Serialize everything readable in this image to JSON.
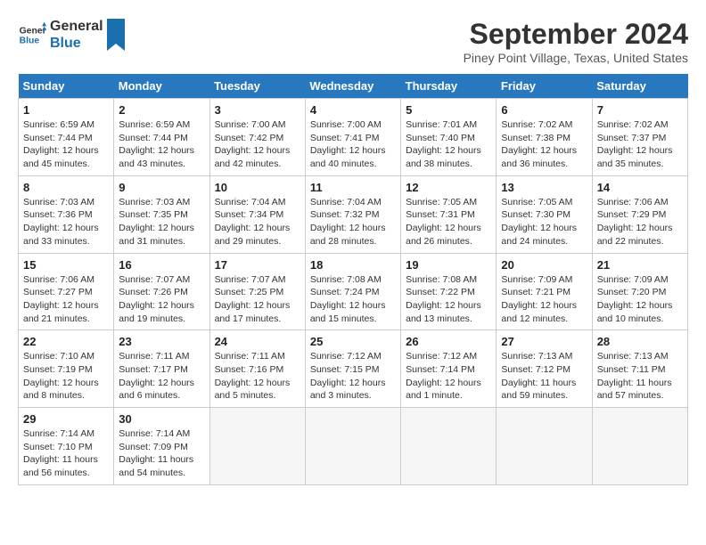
{
  "app": {
    "logo_line1": "General",
    "logo_line2": "Blue"
  },
  "calendar": {
    "month": "September 2024",
    "location": "Piney Point Village, Texas, United States",
    "headers": [
      "Sunday",
      "Monday",
      "Tuesday",
      "Wednesday",
      "Thursday",
      "Friday",
      "Saturday"
    ],
    "weeks": [
      [
        null,
        {
          "day": 2,
          "sunrise": "6:59 AM",
          "sunset": "7:44 PM",
          "daylight": "12 hours and 43 minutes."
        },
        {
          "day": 3,
          "sunrise": "7:00 AM",
          "sunset": "7:42 PM",
          "daylight": "12 hours and 42 minutes."
        },
        {
          "day": 4,
          "sunrise": "7:00 AM",
          "sunset": "7:41 PM",
          "daylight": "12 hours and 40 minutes."
        },
        {
          "day": 5,
          "sunrise": "7:01 AM",
          "sunset": "7:40 PM",
          "daylight": "12 hours and 38 minutes."
        },
        {
          "day": 6,
          "sunrise": "7:02 AM",
          "sunset": "7:38 PM",
          "daylight": "12 hours and 36 minutes."
        },
        {
          "day": 7,
          "sunrise": "7:02 AM",
          "sunset": "7:37 PM",
          "daylight": "12 hours and 35 minutes."
        }
      ],
      [
        {
          "day": 1,
          "sunrise": "6:59 AM",
          "sunset": "7:44 PM",
          "daylight": "12 hours and 45 minutes."
        },
        {
          "day": 8,
          "sunrise": "7:03 AM",
          "sunset": "7:36 PM",
          "daylight": "12 hours and 33 minutes."
        },
        {
          "day": 9,
          "sunrise": "7:03 AM",
          "sunset": "7:35 PM",
          "daylight": "12 hours and 31 minutes."
        },
        {
          "day": 10,
          "sunrise": "7:04 AM",
          "sunset": "7:34 PM",
          "daylight": "12 hours and 29 minutes."
        },
        {
          "day": 11,
          "sunrise": "7:04 AM",
          "sunset": "7:32 PM",
          "daylight": "12 hours and 28 minutes."
        },
        {
          "day": 12,
          "sunrise": "7:05 AM",
          "sunset": "7:31 PM",
          "daylight": "12 hours and 26 minutes."
        },
        {
          "day": 13,
          "sunrise": "7:05 AM",
          "sunset": "7:30 PM",
          "daylight": "12 hours and 24 minutes."
        },
        {
          "day": 14,
          "sunrise": "7:06 AM",
          "sunset": "7:29 PM",
          "daylight": "12 hours and 22 minutes."
        }
      ],
      [
        {
          "day": 15,
          "sunrise": "7:06 AM",
          "sunset": "7:27 PM",
          "daylight": "12 hours and 21 minutes."
        },
        {
          "day": 16,
          "sunrise": "7:07 AM",
          "sunset": "7:26 PM",
          "daylight": "12 hours and 19 minutes."
        },
        {
          "day": 17,
          "sunrise": "7:07 AM",
          "sunset": "7:25 PM",
          "daylight": "12 hours and 17 minutes."
        },
        {
          "day": 18,
          "sunrise": "7:08 AM",
          "sunset": "7:24 PM",
          "daylight": "12 hours and 15 minutes."
        },
        {
          "day": 19,
          "sunrise": "7:08 AM",
          "sunset": "7:22 PM",
          "daylight": "12 hours and 13 minutes."
        },
        {
          "day": 20,
          "sunrise": "7:09 AM",
          "sunset": "7:21 PM",
          "daylight": "12 hours and 12 minutes."
        },
        {
          "day": 21,
          "sunrise": "7:09 AM",
          "sunset": "7:20 PM",
          "daylight": "12 hours and 10 minutes."
        }
      ],
      [
        {
          "day": 22,
          "sunrise": "7:10 AM",
          "sunset": "7:19 PM",
          "daylight": "12 hours and 8 minutes."
        },
        {
          "day": 23,
          "sunrise": "7:11 AM",
          "sunset": "7:17 PM",
          "daylight": "12 hours and 6 minutes."
        },
        {
          "day": 24,
          "sunrise": "7:11 AM",
          "sunset": "7:16 PM",
          "daylight": "12 hours and 5 minutes."
        },
        {
          "day": 25,
          "sunrise": "7:12 AM",
          "sunset": "7:15 PM",
          "daylight": "12 hours and 3 minutes."
        },
        {
          "day": 26,
          "sunrise": "7:12 AM",
          "sunset": "7:14 PM",
          "daylight": "12 hours and 1 minute."
        },
        {
          "day": 27,
          "sunrise": "7:13 AM",
          "sunset": "7:12 PM",
          "daylight": "11 hours and 59 minutes."
        },
        {
          "day": 28,
          "sunrise": "7:13 AM",
          "sunset": "7:11 PM",
          "daylight": "11 hours and 57 minutes."
        }
      ],
      [
        {
          "day": 29,
          "sunrise": "7:14 AM",
          "sunset": "7:10 PM",
          "daylight": "11 hours and 56 minutes."
        },
        {
          "day": 30,
          "sunrise": "7:14 AM",
          "sunset": "7:09 PM",
          "daylight": "11 hours and 54 minutes."
        },
        null,
        null,
        null,
        null,
        null
      ]
    ]
  }
}
